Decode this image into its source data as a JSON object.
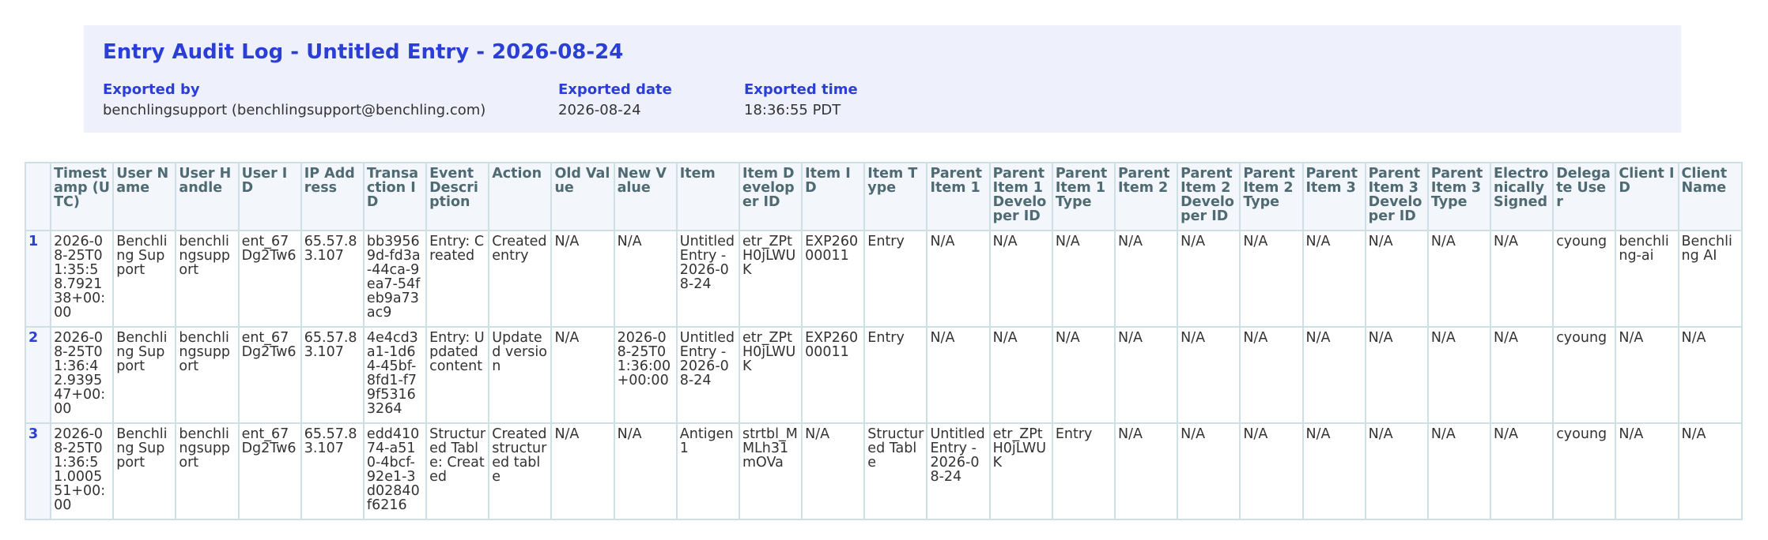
{
  "title": "Entry Audit Log - Untitled Entry - 2026-08-24",
  "exported": {
    "by_label": "Exported by",
    "by_value": "benchlingsupport (benchlingsupport@benchling.com)",
    "date_label": "Exported date",
    "date_value": "2026-08-24",
    "time_label": "Exported time",
    "time_value": "18:36:55 PDT"
  },
  "table": {
    "headers": [
      "Timestamp (UTC)",
      "User Name",
      "User Handle",
      "User ID",
      "IP Address",
      "Transaction ID",
      "Event Description",
      "Action",
      "Old Value",
      "New Value",
      "Item",
      "Item Developer ID",
      "Item ID",
      "Item Type",
      "Parent Item 1",
      "Parent Item 1 Developer ID",
      "Parent Item 1 Type",
      "Parent Item 2",
      "Parent Item 2 Developer ID",
      "Parent Item 2 Type",
      "Parent Item 3",
      "Parent Item 3 Developer ID",
      "Parent Item 3 Type",
      "Electronically Signed",
      "Delegate User",
      "Client ID",
      "Client Name"
    ],
    "rows": [
      {
        "num": "1",
        "cells": [
          "2026-08-25T01:35:58.792138+00:00",
          "Benchling Support",
          "benchlingsupport",
          "ent_67Dg2Tw6",
          "65.57.83.107",
          "bb39569d-fd3a-44ca-9ea7-54feb9a73ac9",
          "Entry: Created",
          "Created entry",
          "N/A",
          "N/A",
          "Untitled Entry - 2026-08-24",
          "etr_ZPtH0jLWUK",
          "EXP26000011",
          "Entry",
          "N/A",
          "N/A",
          "N/A",
          "N/A",
          "N/A",
          "N/A",
          "N/A",
          "N/A",
          "N/A",
          "N/A",
          "cyoung",
          "benchling-ai",
          "Benchling AI"
        ]
      },
      {
        "num": "2",
        "cells": [
          "2026-08-25T01:36:42.939547+00:00",
          "Benchling Support",
          "benchlingsupport",
          "ent_67Dg2Tw6",
          "65.57.83.107",
          "4e4cd3a1-1d64-45bf-8fd1-f79f53163264",
          "Entry: Updated content",
          "Updated version",
          "N/A",
          "2026-08-25T01:36:00+00:00",
          "Untitled Entry - 2026-08-24",
          "etr_ZPtH0jLWUK",
          "EXP26000011",
          "Entry",
          "N/A",
          "N/A",
          "N/A",
          "N/A",
          "N/A",
          "N/A",
          "N/A",
          "N/A",
          "N/A",
          "N/A",
          "cyoung",
          "N/A",
          "N/A"
        ]
      },
      {
        "num": "3",
        "cells": [
          "2026-08-25T01:36:51.000551+00:00",
          "Benchling Support",
          "benchlingsupport",
          "ent_67Dg2Tw6",
          "65.57.83.107",
          "edd41074-a510-4bcf-92e1-3d02840f6216",
          "Structured Table: Created",
          "Created structured table",
          "N/A",
          "N/A",
          "Antigen 1",
          "strtbl_MMLh31mOVa",
          "N/A",
          "Structured Table",
          "Untitled Entry - 2026-08-24",
          "etr_ZPtH0jLWUK",
          "Entry",
          "N/A",
          "N/A",
          "N/A",
          "N/A",
          "N/A",
          "N/A",
          "N/A",
          "cyoung",
          "N/A",
          "N/A"
        ]
      }
    ]
  }
}
